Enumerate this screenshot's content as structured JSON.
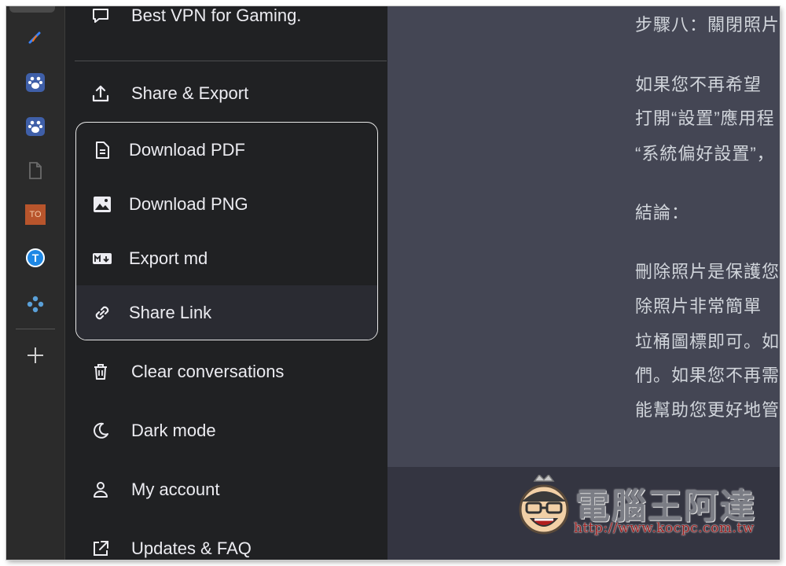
{
  "sidebar": {
    "conversation": {
      "label": "Best VPN for Gaming.",
      "icon": "chat-bubble-icon"
    },
    "share_export": {
      "label": "Share & Export",
      "icon": "upload-icon"
    },
    "submenu": [
      {
        "label": "Download PDF",
        "icon": "document-icon"
      },
      {
        "label": "Download PNG",
        "icon": "image-icon"
      },
      {
        "label": "Export md",
        "icon": "markdown-icon"
      },
      {
        "label": "Share Link",
        "icon": "link-icon"
      }
    ],
    "items": [
      {
        "label": "Clear conversations",
        "icon": "trash-icon"
      },
      {
        "label": "Dark mode",
        "icon": "moon-icon"
      },
      {
        "label": "My account",
        "icon": "user-icon"
      },
      {
        "label": "Updates & FAQ",
        "icon": "external-link-icon"
      }
    ]
  },
  "rail": {
    "icons": [
      "pen-icon",
      "baidu-icon",
      "baidu-icon",
      "file-icon",
      "to-icon",
      "t-circle-icon",
      "dots-icon",
      "plus-icon"
    ],
    "to_label": "TO",
    "t_label": "T"
  },
  "content": {
    "lines": [
      "步驟八：關閉照片",
      "如果您不再希望",
      "打開“設置”應用程",
      "“系統偏好設置”，",
      "結論：",
      "刪除照片是保護您",
      "除照片非常簡單",
      "垃桶圖標即可。如",
      "們。如果您不再需",
      "能幫助您更好地管"
    ]
  },
  "watermark": {
    "title": "電腦王阿達",
    "url": "http://www.kocpc.com.tw"
  },
  "colors": {
    "sidebar_bg": "#202123",
    "content_bg": "#444654",
    "text": "#ececf1",
    "hover": "#2a2b32"
  }
}
